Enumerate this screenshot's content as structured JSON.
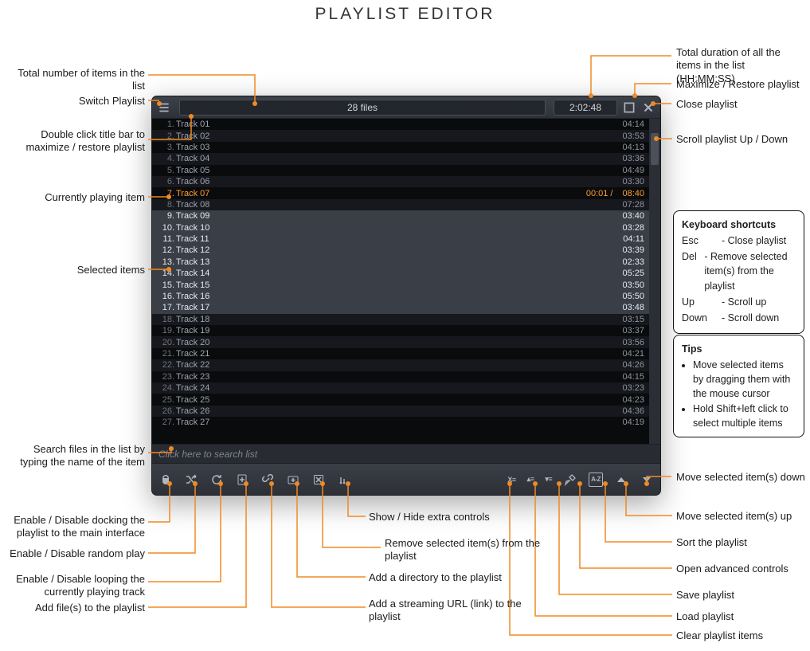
{
  "page_title": "PLAYLIST EDITOR",
  "header": {
    "file_count_label": "28 files",
    "total_duration": "2:02:48"
  },
  "playing_index": 6,
  "playing_progress": "00:01 /",
  "selected_indices": [
    8,
    9,
    10,
    11,
    12,
    13,
    14,
    15,
    16
  ],
  "tracks": [
    {
      "num": "1.",
      "name": "Track 01",
      "dur": "04:14"
    },
    {
      "num": "2.",
      "name": "Track 02",
      "dur": "03:53"
    },
    {
      "num": "3.",
      "name": "Track 03",
      "dur": "04:13"
    },
    {
      "num": "4.",
      "name": "Track 04",
      "dur": "03:36"
    },
    {
      "num": "5.",
      "name": "Track 05",
      "dur": "04:49"
    },
    {
      "num": "6.",
      "name": "Track 06",
      "dur": "03:30"
    },
    {
      "num": "7.",
      "name": "Track 07",
      "dur": "08:40"
    },
    {
      "num": "8.",
      "name": "Track 08",
      "dur": "07:28"
    },
    {
      "num": "9.",
      "name": "Track 09",
      "dur": "03:40"
    },
    {
      "num": "10.",
      "name": "Track 10",
      "dur": "03:28"
    },
    {
      "num": "11.",
      "name": "Track 11",
      "dur": "04:11"
    },
    {
      "num": "12.",
      "name": "Track 12",
      "dur": "03:39"
    },
    {
      "num": "13.",
      "name": "Track 13",
      "dur": "02:33"
    },
    {
      "num": "14.",
      "name": "Track 14",
      "dur": "05:25"
    },
    {
      "num": "15.",
      "name": "Track 15",
      "dur": "03:50"
    },
    {
      "num": "16.",
      "name": "Track 16",
      "dur": "05:50"
    },
    {
      "num": "17.",
      "name": "Track 17",
      "dur": "03:48"
    },
    {
      "num": "18.",
      "name": "Track 18",
      "dur": "03:15"
    },
    {
      "num": "19.",
      "name": "Track 19",
      "dur": "03:37"
    },
    {
      "num": "20.",
      "name": "Track 20",
      "dur": "03:56"
    },
    {
      "num": "21.",
      "name": "Track 21",
      "dur": "04:21"
    },
    {
      "num": "22.",
      "name": "Track 22",
      "dur": "04:26"
    },
    {
      "num": "23.",
      "name": "Track 23",
      "dur": "04:15"
    },
    {
      "num": "24.",
      "name": "Track 24",
      "dur": "03:23"
    },
    {
      "num": "25.",
      "name": "Track 25",
      "dur": "04:23"
    },
    {
      "num": "26.",
      "name": "Track 26",
      "dur": "04:36"
    },
    {
      "num": "27.",
      "name": "Track 27",
      "dur": "04:19"
    }
  ],
  "search_placeholder": "Click here to search list",
  "callouts": {
    "left": {
      "total_items": "Total number of items in the list",
      "switch_playlist": "Switch Playlist",
      "dbl_title": "Double click title bar to maximize / restore playlist",
      "playing": "Currently playing item",
      "selected": "Selected items",
      "search": "Search files in the list by typing the name of the item",
      "dock": "Enable / Disable docking the playlist to the main interface",
      "random": "Enable / Disable random play",
      "loop": "Enable / Disable looping the currently playing track",
      "add_file": "Add file(s) to the playlist"
    },
    "right": {
      "total_dur": "Total duration of all the items in the list (HH:MM:SS)",
      "maximize": "Maximize / Restore playlist",
      "close": "Close playlist",
      "scroll": "Scroll playlist Up / Down",
      "move_down": "Move selected item(s) down",
      "move_up": "Move selected item(s) up",
      "sort": "Sort the playlist",
      "advanced": "Open advanced controls",
      "save": "Save playlist",
      "load": "Load playlist",
      "clear": "Clear playlist items"
    },
    "center": {
      "extra": "Show / Hide extra controls",
      "remove_sel": "Remove selected item(s) from the playlist",
      "add_dir": "Add a directory to the playlist",
      "add_url": "Add a streaming URL (link) to the playlist"
    }
  },
  "shortcuts": {
    "title": "Keyboard shortcuts",
    "rows": [
      {
        "k": "Esc",
        "v": "- Close playlist"
      },
      {
        "k": "Del",
        "v": "- Remove selected item(s) from the playlist"
      },
      {
        "k": "Up",
        "v": "- Scroll up"
      },
      {
        "k": "Down",
        "v": "- Scroll down"
      }
    ]
  },
  "tips": {
    "title": "Tips",
    "items": [
      "Move selected items by dragging them with the mouse cursor",
      "Hold Shift+left click to select multiple items"
    ]
  }
}
